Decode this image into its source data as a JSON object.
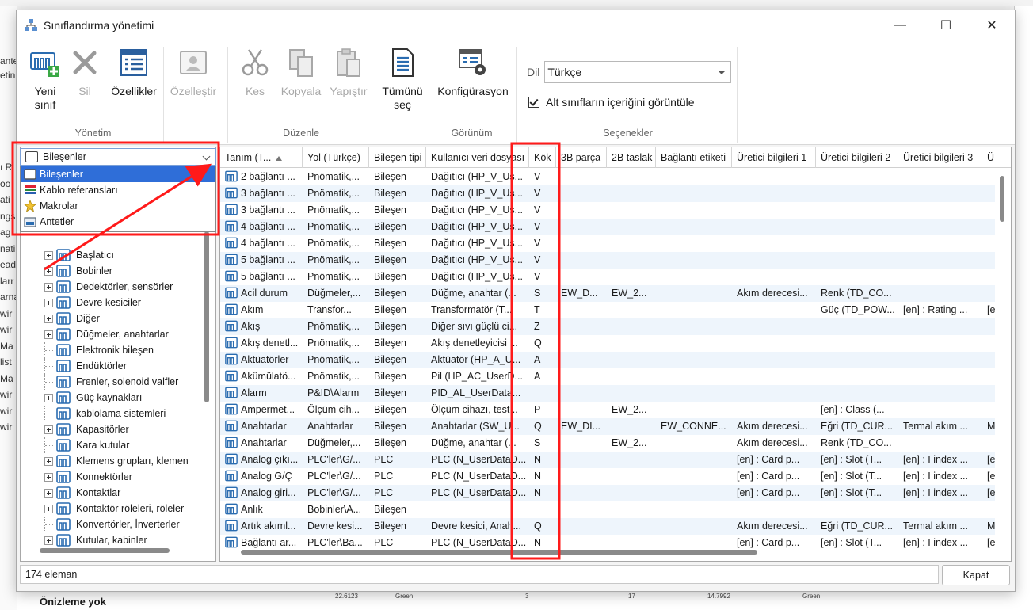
{
  "background": {
    "left_snippets": [
      "ı R",
      "oo",
      "ati",
      "ngs",
      "ag",
      "nati",
      "ead",
      "larr",
      "arna",
      "wir",
      "wir",
      "Ma",
      "list",
      "Ma",
      "wir",
      "wir",
      "wir"
    ],
    "left_top_snippets": [
      "ante",
      "etin"
    ],
    "preview_text": "Önizleme yok",
    "sheet_values": [
      "22.6123",
      "Green",
      "3",
      "17",
      "14.7992",
      "Green"
    ]
  },
  "dialog": {
    "title": "Sınıflandırma yönetimi",
    "controls": {
      "minimize": "—",
      "maximize": "☐",
      "close": "✕"
    }
  },
  "ribbon": {
    "groups": {
      "yonetim": "Yönetim",
      "duzenle": "Düzenle",
      "gorunum": "Görünüm",
      "secenekler": "Seçenekler"
    },
    "buttons": {
      "yeni_sinif": [
        "Yeni",
        "sınıf"
      ],
      "sil": "Sil",
      "ozellikler": "Özellikler",
      "ozellestir": "Özelleştir",
      "kes": "Kes",
      "kopyala": "Kopyala",
      "yapistir": "Yapıştır",
      "tumunu_sec": [
        "Tümünü",
        "seç"
      ],
      "konfigurasyon": "Konfigürasyon"
    },
    "options": {
      "dil_label": "Dil",
      "dil_value": "Türkçe",
      "alt_siniflar": "Alt sınıfların içeriğini görüntüle",
      "alt_siniflar_checked": true
    }
  },
  "combo": {
    "value": "Bileşenler",
    "options": [
      {
        "label": "Bileşenler",
        "selected": true,
        "icon": "component-icon"
      },
      {
        "label": "Kablo referansları",
        "selected": false,
        "icon": "cable-icon"
      },
      {
        "label": "Makrolar",
        "selected": false,
        "icon": "star-icon"
      },
      {
        "label": "Antetler",
        "selected": false,
        "icon": "title-block-icon"
      }
    ]
  },
  "tree": {
    "items": [
      {
        "label": "Başlatıcı",
        "expandable": true
      },
      {
        "label": "Bobinler",
        "expandable": true
      },
      {
        "label": "Dedektörler, sensörler",
        "expandable": true
      },
      {
        "label": "Devre kesiciler",
        "expandable": true
      },
      {
        "label": "Diğer",
        "expandable": true
      },
      {
        "label": "Düğmeler, anahtarlar",
        "expandable": true
      },
      {
        "label": "Elektronik bileşen",
        "expandable": false
      },
      {
        "label": "Endüktörler",
        "expandable": false
      },
      {
        "label": "Frenler, solenoid valfler",
        "expandable": false
      },
      {
        "label": "Güç kaynakları",
        "expandable": true
      },
      {
        "label": "kablolama sistemleri",
        "expandable": false
      },
      {
        "label": "Kapasitörler",
        "expandable": true
      },
      {
        "label": "Kara kutular",
        "expandable": false
      },
      {
        "label": "Klemens grupları, klemen",
        "expandable": true
      },
      {
        "label": "Konnektörler",
        "expandable": true
      },
      {
        "label": "Kontaktlar",
        "expandable": true
      },
      {
        "label": "Kontaktör röleleri, röleler",
        "expandable": true
      },
      {
        "label": "Konvertörler, İnverterler",
        "expandable": false
      },
      {
        "label": "Kutular, kabinler",
        "expandable": true
      }
    ]
  },
  "grid": {
    "columns": [
      "Tanım (T...",
      "Yol (Türkçe)",
      "Bileşen tipi",
      "Kullanıcı veri dosyası",
      "Kök",
      "3B parça",
      "2B taslak",
      "Bağlantı etiketi",
      "Üretici bilgileri 1",
      "Üretici bilgileri 2",
      "Üretici bilgileri 3",
      "Ü"
    ],
    "rows": [
      [
        "2 bağlantı ...",
        "Pnömatik,...",
        "Bileşen",
        "Dağıtıcı (HP_V_Us...",
        "V",
        "",
        "",
        "",
        "",
        "",
        "",
        ""
      ],
      [
        "3 bağlantı ...",
        "Pnömatik,...",
        "Bileşen",
        "Dağıtıcı (HP_V_Us...",
        "V",
        "",
        "",
        "",
        "",
        "",
        "",
        ""
      ],
      [
        "3 bağlantı ...",
        "Pnömatik,...",
        "Bileşen",
        "Dağıtıcı (HP_V_Us...",
        "V",
        "",
        "",
        "",
        "",
        "",
        "",
        ""
      ],
      [
        "4 bağlantı ...",
        "Pnömatik,...",
        "Bileşen",
        "Dağıtıcı (HP_V_Us...",
        "V",
        "",
        "",
        "",
        "",
        "",
        "",
        ""
      ],
      [
        "4 bağlantı ...",
        "Pnömatik,...",
        "Bileşen",
        "Dağıtıcı (HP_V_Us...",
        "V",
        "",
        "",
        "",
        "",
        "",
        "",
        ""
      ],
      [
        "5 bağlantı ...",
        "Pnömatik,...",
        "Bileşen",
        "Dağıtıcı (HP_V_Us...",
        "V",
        "",
        "",
        "",
        "",
        "",
        "",
        ""
      ],
      [
        "5 bağlantı ...",
        "Pnömatik,...",
        "Bileşen",
        "Dağıtıcı (HP_V_Us...",
        "V",
        "",
        "",
        "",
        "",
        "",
        "",
        ""
      ],
      [
        "Acil durum",
        "Düğmeler,...",
        "Bileşen",
        "Düğme, anahtar (...",
        "S",
        "EW_D...",
        "EW_2...",
        "",
        "Akım derecesi...",
        "Renk (TD_CO...",
        "",
        ""
      ],
      [
        "Akım",
        "Transfor...",
        "Bileşen",
        "Transformatör (T...",
        "T",
        "",
        "",
        "",
        "",
        "Güç (TD_POW...",
        "[en] : Rating ...",
        "[e"
      ],
      [
        "Akış",
        "Pnömatik,...",
        "Bileşen",
        "Diğer sıvı güçlü ci...",
        "Z",
        "",
        "",
        "",
        "",
        "",
        "",
        ""
      ],
      [
        "Akış denetl...",
        "Pnömatik,...",
        "Bileşen",
        "Akış denetleyicisi ...",
        "Q",
        "",
        "",
        "",
        "",
        "",
        "",
        ""
      ],
      [
        "Aktüatörler",
        "Pnömatik,...",
        "Bileşen",
        "Aktüatör (HP_A_U...",
        "A",
        "",
        "",
        "",
        "",
        "",
        "",
        ""
      ],
      [
        "Akümülatö...",
        "Pnömatik,...",
        "Bileşen",
        "Pil (HP_AC_UserD...",
        "A",
        "",
        "",
        "",
        "",
        "",
        "",
        ""
      ],
      [
        "Alarm",
        "P&ID\\Alarm",
        "Bileşen",
        "PID_AL_UserData...",
        "",
        "",
        "",
        "",
        "",
        "",
        "",
        ""
      ],
      [
        "Ampermet...",
        "Ölçüm cih...",
        "Bileşen",
        "Ölçüm cihazı, test...",
        "P",
        "",
        "EW_2...",
        "",
        "",
        "[en] : Class (...",
        "",
        ""
      ],
      [
        "Anahtarlar",
        "Anahtarlar",
        "Bileşen",
        "Anahtarlar (SW_U...",
        "Q",
        "EW_DI...",
        "",
        "EW_CONNE...",
        "Akım derecesi...",
        "Eğri (TD_CUR...",
        "Termal akım ...",
        "M"
      ],
      [
        "Anahtarlar",
        "Düğmeler,...",
        "Bileşen",
        "Düğme, anahtar (...",
        "S",
        "",
        "EW_2...",
        "",
        "Akım derecesi...",
        "Renk (TD_CO...",
        "",
        ""
      ],
      [
        "Analog çıkı...",
        "PLC'ler\\G/...",
        "PLC",
        "PLC (N_UserDataD...",
        "N",
        "",
        "",
        "",
        "[en] : Card p...",
        "[en] : Slot (T...",
        "[en] : I index ...",
        "[e"
      ],
      [
        "Analog G/Ç",
        "PLC'ler\\G/...",
        "PLC",
        "PLC (N_UserDataD...",
        "N",
        "",
        "",
        "",
        "[en] : Card p...",
        "[en] : Slot (T...",
        "[en] : I index ...",
        "[e"
      ],
      [
        "Analog giri...",
        "PLC'ler\\G/...",
        "PLC",
        "PLC (N_UserDataD...",
        "N",
        "",
        "",
        "",
        "[en] : Card p...",
        "[en] : Slot (T...",
        "[en] : I index ...",
        "[e"
      ],
      [
        "Anlık",
        "Bobinler\\A...",
        "Bileşen",
        "",
        "",
        "",
        "",
        "",
        "",
        "",
        "",
        ""
      ],
      [
        "Artık akıml...",
        "Devre kesi...",
        "Bileşen",
        "Devre kesici, Anah...",
        "Q",
        "",
        "",
        "",
        "Akım derecesi...",
        "Eğri (TD_CUR...",
        "Termal akım ...",
        "M"
      ],
      [
        "Bağlantı ar...",
        "PLC'ler\\Ba...",
        "PLC",
        "PLC (N_UserDataD...",
        "N",
        "",
        "",
        "",
        "[en] : Card p...",
        "[en] : Slot (T...",
        "[en] : I index ...",
        "[e"
      ]
    ]
  },
  "status": {
    "count_text": "174 eleman"
  },
  "close_button": "Kapat",
  "colors": {
    "accent": "#2f6ed8",
    "annotation": "#ff1a1a",
    "row_alt": "#eef5fc"
  }
}
